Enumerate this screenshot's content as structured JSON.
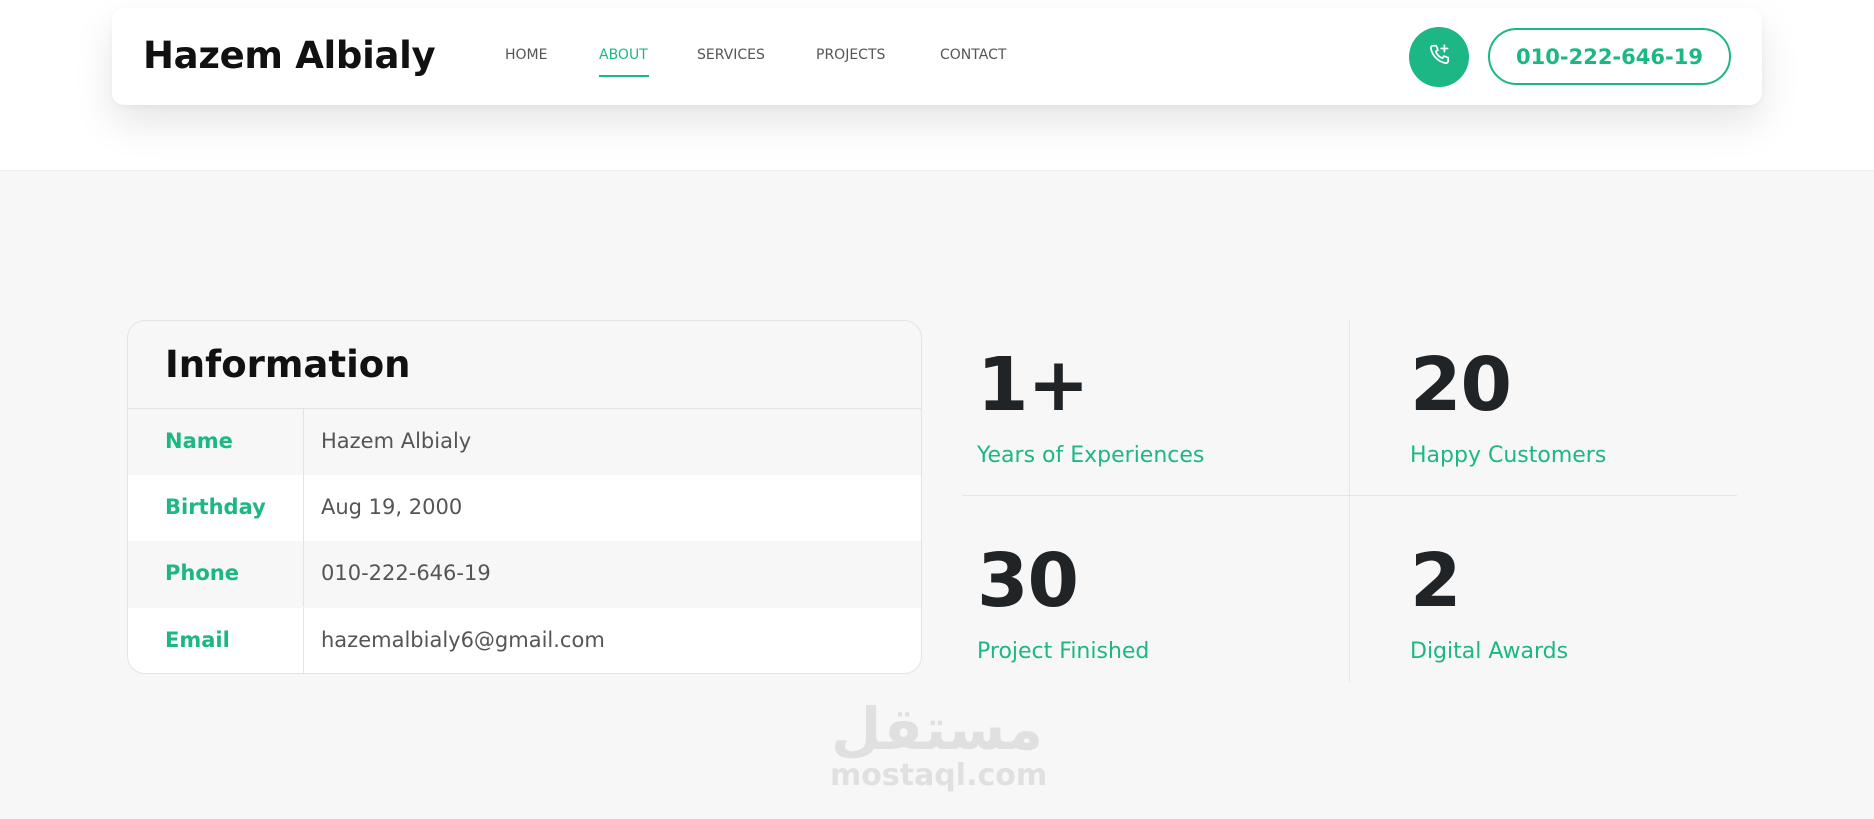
{
  "header": {
    "brand": "Hazem Albialy",
    "nav": [
      "HOME",
      "ABOUT",
      "SERVICES",
      "PROJECTS",
      "CONTACT"
    ],
    "active_nav": "ABOUT",
    "phone_icon": "phone-call-icon",
    "phone_label": "010-222-646-19"
  },
  "info": {
    "title": "Information",
    "rows": [
      {
        "key": "Name",
        "value": "Hazem Albialy"
      },
      {
        "key": "Birthday",
        "value": "Aug 19, 2000"
      },
      {
        "key": "Phone",
        "value": "010-222-646-19"
      },
      {
        "key": "Email",
        "value": "hazemalbialy6@gmail.com"
      }
    ]
  },
  "stats": [
    {
      "number": "1+",
      "label": "Years of Experiences"
    },
    {
      "number": "20",
      "label": "Happy Customers"
    },
    {
      "number": "30",
      "label": "Project Finished"
    },
    {
      "number": "2",
      "label": "Digital Awards"
    }
  ],
  "watermark": {
    "arabic": "مستقل",
    "latin": "mostaql.com"
  },
  "colors": {
    "accent": "#1cb784",
    "text_dark": "#202427",
    "background": "#f7f7f7"
  }
}
